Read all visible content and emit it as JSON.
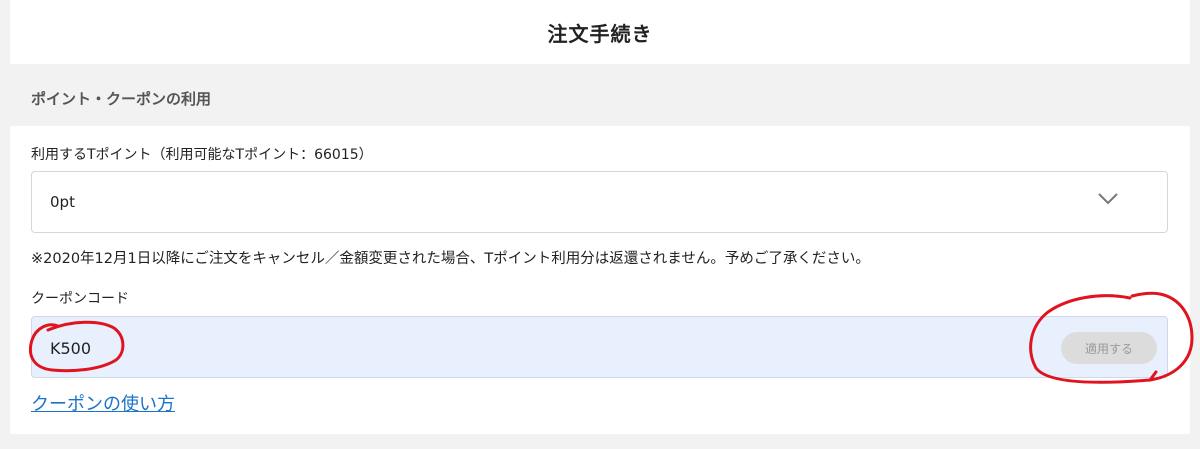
{
  "header": {
    "title": "注文手続き"
  },
  "section": {
    "title": "ポイント・クーポンの利用"
  },
  "points": {
    "label": "利用するTポイント（利用可能なTポイント：66015）",
    "selected_value": "0pt",
    "notice": "※2020年12月1日以降にご注文をキャンセル／金額変更された場合、Tポイント利用分は返還されません。予めご了承ください。"
  },
  "coupon": {
    "label": "クーポンコード",
    "value": "K500",
    "apply_label": "適用する",
    "howto_link": "クーポンの使い方"
  },
  "colors": {
    "link": "#1a73c8",
    "input_bg": "#e8f0fe",
    "annotation": "#e0141e",
    "button_disabled_bg": "#dcdcdc"
  },
  "icons": {
    "dropdown": "chevron-down-icon"
  }
}
